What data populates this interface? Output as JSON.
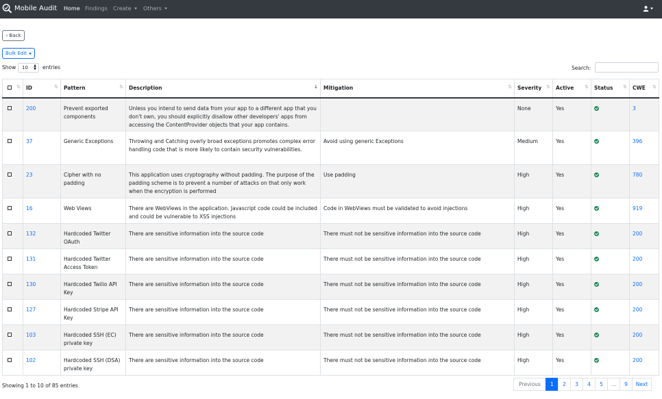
{
  "nav": {
    "brand": "Mobile Audit",
    "home": "Home",
    "findings": "Findings",
    "create": "Create",
    "others": "Others"
  },
  "buttons": {
    "back": "Back",
    "bulk_edit": "Bulk Edit"
  },
  "table_controls": {
    "show_label": "Show",
    "page_size": "10",
    "entries_label": "entries",
    "search_label": "Search:",
    "search_value": ""
  },
  "columns": [
    "ID",
    "Pattern",
    "Description",
    "Mitigation",
    "Severity",
    "Active",
    "Status",
    "CWE"
  ],
  "rows": [
    {
      "id": "200",
      "pattern": "Prevent exported components",
      "description": "Unless you intend to send data from your app to a different app that you don't own, you should explicitly disallow other developers' apps from accessing the ContentProvider objects that your app contains.",
      "mitigation": "",
      "severity": "None",
      "active": "Yes",
      "status": "ok",
      "cwe": "3"
    },
    {
      "id": "37",
      "pattern": "Generic Exceptions",
      "description": "Throwing and Catching overly broad exceptions promotes complex error handling code that is more likely to contain security vulnerabilities.",
      "mitigation": "Avoid using generic Exceptions",
      "severity": "Medium",
      "active": "Yes",
      "status": "ok",
      "cwe": "396"
    },
    {
      "id": "23",
      "pattern": "Cipher with no padding",
      "description": "This application uses cryptography without padding. The purpose of the padding scheme is to prevent a number of attacks on that only work when the encryption is performed",
      "mitigation": "Use padding",
      "severity": "High",
      "active": "Yes",
      "status": "ok",
      "cwe": "780"
    },
    {
      "id": "16",
      "pattern": "Web Views",
      "description": "There are WebViews in the application. Javascript code could be included and could be vulnerable to XSS injections",
      "mitigation": "Code in WebViews must be validated to avoid injections",
      "severity": "High",
      "active": "Yes",
      "status": "ok",
      "cwe": "919"
    },
    {
      "id": "132",
      "pattern": "Hardcoded Twitter OAuth",
      "description": "There are sensitive information into the source code",
      "mitigation": "There must not be sensitive information into the source code",
      "severity": "High",
      "active": "Yes",
      "status": "ok",
      "cwe": "200"
    },
    {
      "id": "131",
      "pattern": "Hardcoded Twitter Access Token",
      "description": "There are sensitive information into the source code",
      "mitigation": "There must not be sensitive information into the source code",
      "severity": "High",
      "active": "Yes",
      "status": "ok",
      "cwe": "200"
    },
    {
      "id": "130",
      "pattern": "Hardcoded Twilio API Key",
      "description": "There are sensitive information into the source code",
      "mitigation": "There must not be sensitive information into the source code",
      "severity": "High",
      "active": "Yes",
      "status": "ok",
      "cwe": "200"
    },
    {
      "id": "127",
      "pattern": "Hardcoded Stripe API Key",
      "description": "There are sensitive information into the source code",
      "mitigation": "There must not be sensitive information into the source code",
      "severity": "High",
      "active": "Yes",
      "status": "ok",
      "cwe": "200"
    },
    {
      "id": "103",
      "pattern": "Hardcoded SSH (EC) private key",
      "description": "There are sensitive information into the source code",
      "mitigation": "There must not be sensitive information into the source code",
      "severity": "High",
      "active": "Yes",
      "status": "ok",
      "cwe": "200"
    },
    {
      "id": "102",
      "pattern": "Hardcoded SSH (DSA) private key",
      "description": "There are sensitive information into the source code",
      "mitigation": "There must not be sensitive information into the source code",
      "severity": "High",
      "active": "Yes",
      "status": "ok",
      "cwe": "200"
    }
  ],
  "footer": {
    "info": "Showing 1 to 10 of 85 entries",
    "pages": [
      "Previous",
      "1",
      "2",
      "3",
      "4",
      "5",
      "...",
      "9",
      "Next"
    ],
    "active_page": "1"
  },
  "icons": {
    "brand": "magnifier-logo-icon",
    "user": "user-icon",
    "status_ok": "check-circle-icon",
    "sort": "sort-arrows-icon"
  },
  "colors": {
    "navbar": "#343a40",
    "link": "#0d6efd",
    "status_ok": "#198754",
    "stripe": "#f2f2f2"
  }
}
